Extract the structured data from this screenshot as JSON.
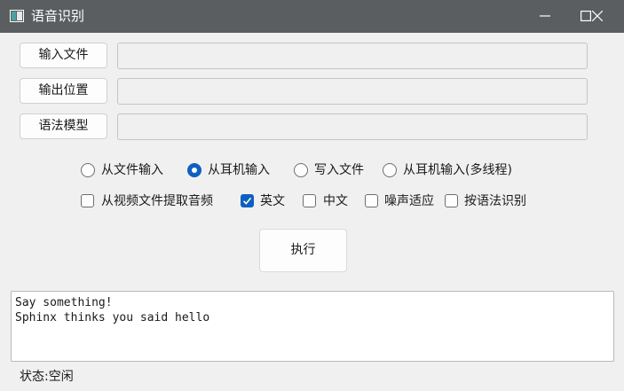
{
  "window": {
    "title": "语音识别",
    "controls": [
      "minimize-icon",
      "maximize-icon",
      "close-icon"
    ]
  },
  "file_rows": [
    {
      "button": "输入文件",
      "value": ""
    },
    {
      "button": "输出位置",
      "value": ""
    },
    {
      "button": "语法模型",
      "value": ""
    }
  ],
  "mode_radios": [
    {
      "label": "从文件输入",
      "selected": false
    },
    {
      "label": "从耳机输入",
      "selected": true
    },
    {
      "label": "写入文件",
      "selected": false
    },
    {
      "label": "从耳机输入(多线程)",
      "selected": false
    }
  ],
  "option_checks": [
    {
      "label": "从视频文件提取音频",
      "checked": false
    },
    {
      "label": "英文",
      "checked": true
    },
    {
      "label": "中文",
      "checked": false
    },
    {
      "label": "噪声适应",
      "checked": false
    },
    {
      "label": "按语法识别",
      "checked": false
    }
  ],
  "execute_label": "执行",
  "output_lines": [
    "Say something!",
    "Sphinx thinks you said hello"
  ],
  "status": "状态:空闲",
  "colors": {
    "titlebar": "#5b5e61",
    "accent": "#0f5fc0",
    "window_bg": "#f0f0f0"
  }
}
